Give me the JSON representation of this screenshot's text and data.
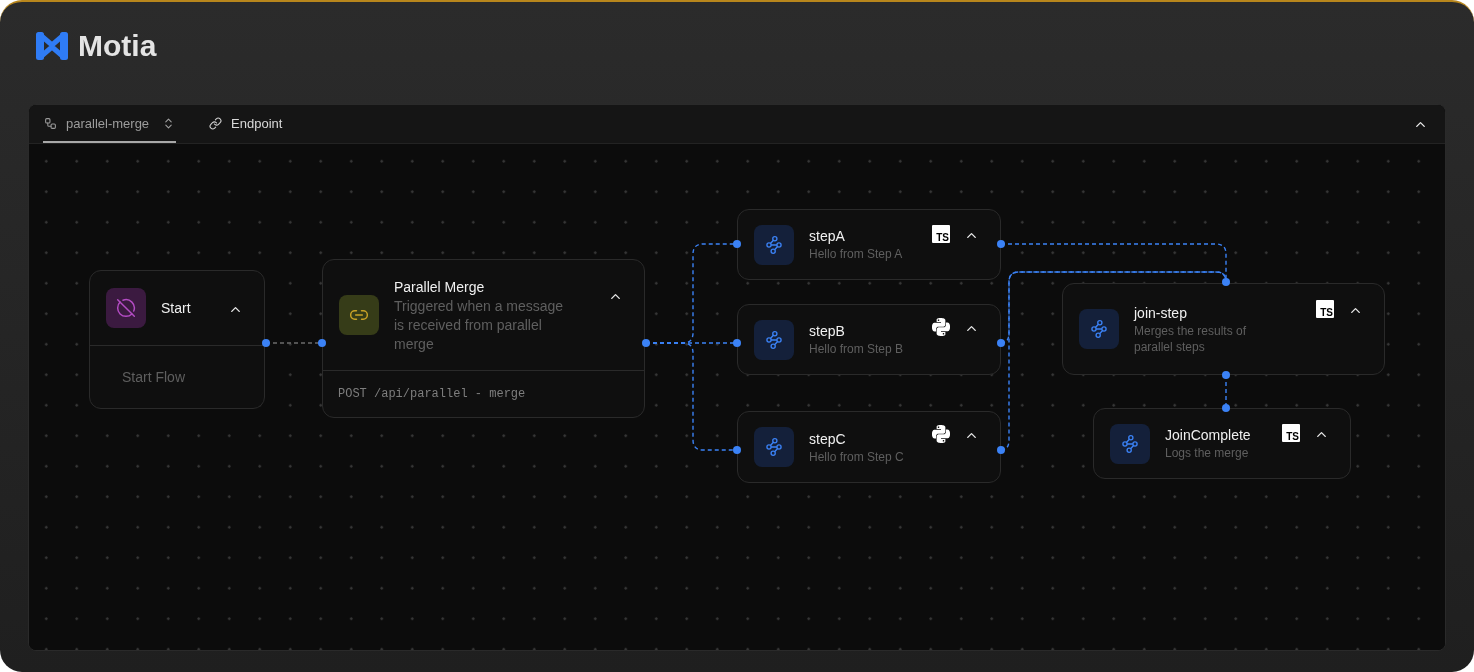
{
  "brand": {
    "name": "Motia"
  },
  "tabs": [
    {
      "kind": "flow_select",
      "label": "parallel-merge",
      "selected": true
    },
    {
      "kind": "endpoint",
      "label": "Endpoint",
      "selected": false
    }
  ],
  "nodes": [
    {
      "kind": "noop",
      "title": "Start",
      "footer": {
        "kind": "text",
        "text": "Start Flow"
      }
    },
    {
      "kind": "api",
      "title": "Parallel Merge",
      "description": "Triggered when a message is received from parallel merge",
      "footer": {
        "kind": "code",
        "text": "POST /api/parallel - merge"
      }
    },
    {
      "kind": "event",
      "title": "stepA",
      "description": "Hello from Step A",
      "language": {
        "kind": "typescript",
        "label": "TS"
      }
    },
    {
      "kind": "event",
      "title": "stepB",
      "description": "Hello from Step B",
      "language": {
        "kind": "python"
      }
    },
    {
      "kind": "event",
      "title": "stepC",
      "description": "Hello from Step C",
      "language": {
        "kind": "python"
      }
    },
    {
      "kind": "event",
      "title": "join-step",
      "description": "Merges the results of parallel steps",
      "language": {
        "kind": "typescript",
        "label": "TS"
      }
    },
    {
      "kind": "event",
      "title": "JoinComplete",
      "description": "Logs the merge",
      "language": {
        "kind": "typescript",
        "label": "TS"
      }
    }
  ],
  "edges": [
    {
      "kind": "noop"
    },
    {
      "kind": "event"
    },
    {
      "kind": "event"
    },
    {
      "kind": "event"
    },
    {
      "kind": "event"
    },
    {
      "kind": "event"
    },
    {
      "kind": "event"
    },
    {
      "kind": "event"
    }
  ]
}
